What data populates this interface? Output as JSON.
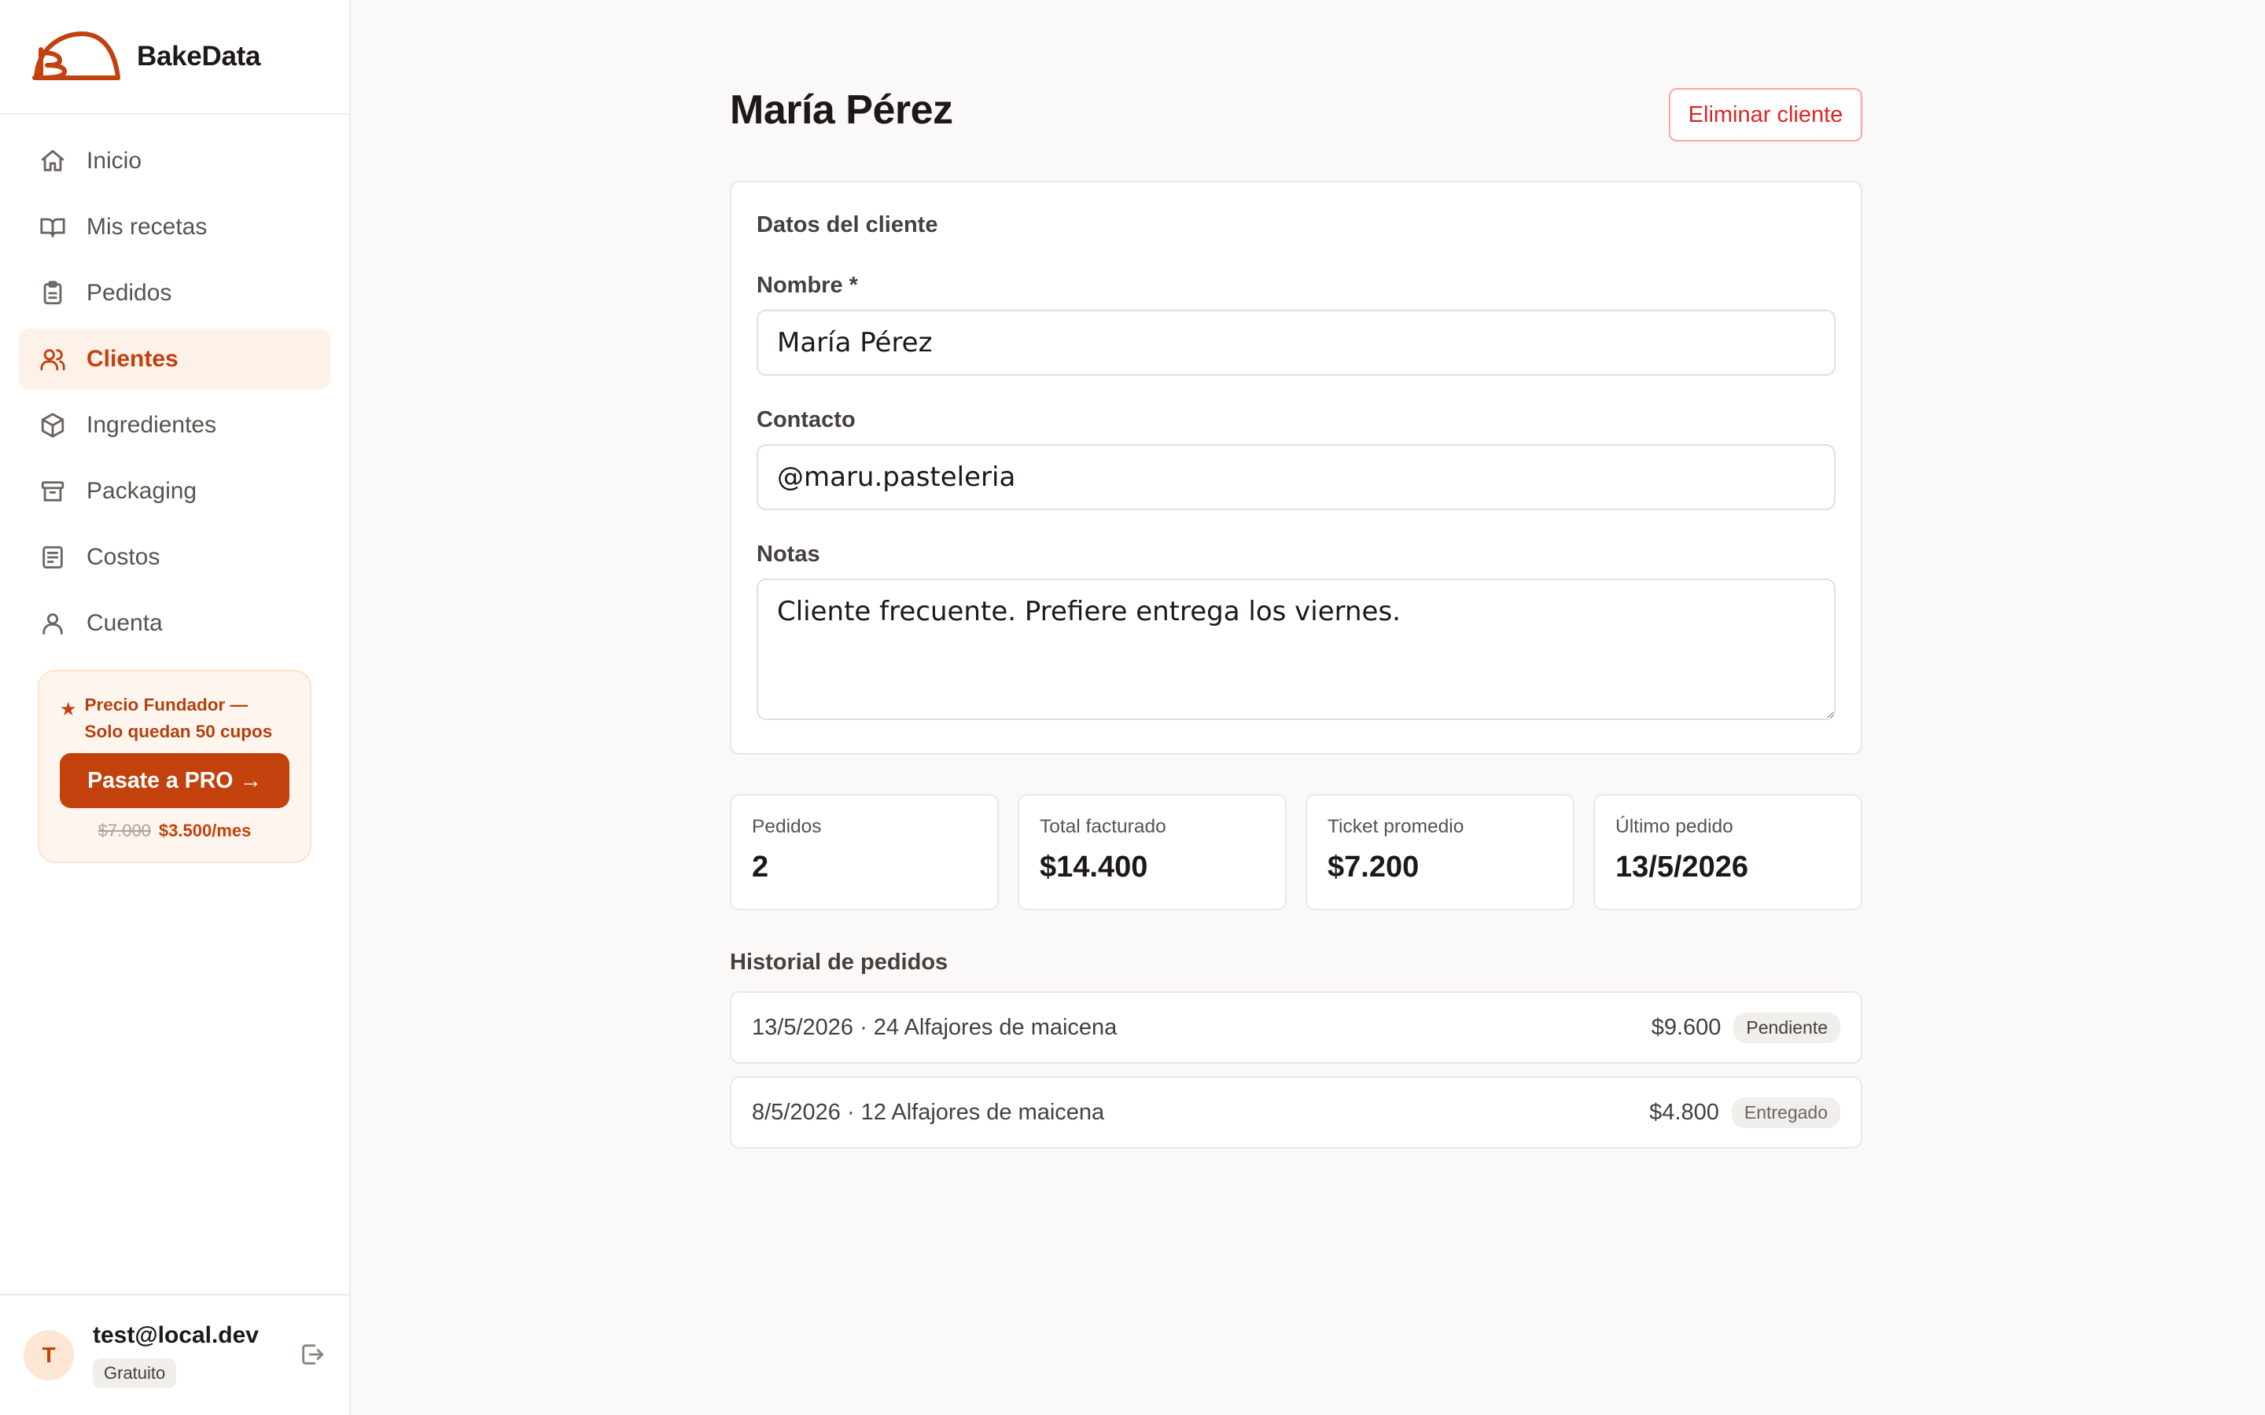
{
  "app": {
    "name": "BakeData",
    "logo_icon": "bakedata-logo-icon"
  },
  "sidebar": {
    "items": [
      {
        "label": "Inicio",
        "icon": "home-icon",
        "active": false
      },
      {
        "label": "Mis recetas",
        "icon": "book-icon",
        "active": false
      },
      {
        "label": "Pedidos",
        "icon": "clipboard-icon",
        "active": false
      },
      {
        "label": "Clientes",
        "icon": "users-icon",
        "active": true
      },
      {
        "label": "Ingredientes",
        "icon": "box-icon",
        "active": false
      },
      {
        "label": "Packaging",
        "icon": "archive-icon",
        "active": false
      },
      {
        "label": "Costos",
        "icon": "receipt-icon",
        "active": false
      },
      {
        "label": "Cuenta",
        "icon": "user-icon",
        "active": false
      }
    ],
    "promo": {
      "text": "Precio Fundador — Solo quedan 50 cupos",
      "button_label": "Pasate a PRO →",
      "old_price": "$7.000",
      "new_price": "$3.500/mes"
    },
    "user": {
      "initial": "T",
      "email": "test@local.dev",
      "plan": "Gratuito"
    }
  },
  "page": {
    "title": "María Pérez",
    "delete_label": "Eliminar cliente"
  },
  "form": {
    "section_title": "Datos del cliente",
    "name_label": "Nombre *",
    "name_value": "María Pérez",
    "contact_label": "Contacto",
    "contact_value": "@maru.pasteleria",
    "notes_label": "Notas",
    "notes_value": "Cliente frecuente. Prefiere entrega los viernes."
  },
  "stats": [
    {
      "label": "Pedidos",
      "value": "2"
    },
    {
      "label": "Total facturado",
      "value": "$14.400"
    },
    {
      "label": "Ticket promedio",
      "value": "$7.200"
    },
    {
      "label": "Último pedido",
      "value": "13/5/2026"
    }
  ],
  "history": {
    "title": "Historial de pedidos",
    "orders": [
      {
        "desc": "13/5/2026 · 24 Alfajores de maicena",
        "amount": "$9.600",
        "status": "Pendiente"
      },
      {
        "desc": "8/5/2026 · 12 Alfajores de maicena",
        "amount": "$4.800",
        "status": "Entregado"
      }
    ]
  },
  "colors": {
    "accent": "#c2410c",
    "active_bg": "#fdf1e8",
    "danger": "#dc2626",
    "background": "#faf9f7"
  }
}
